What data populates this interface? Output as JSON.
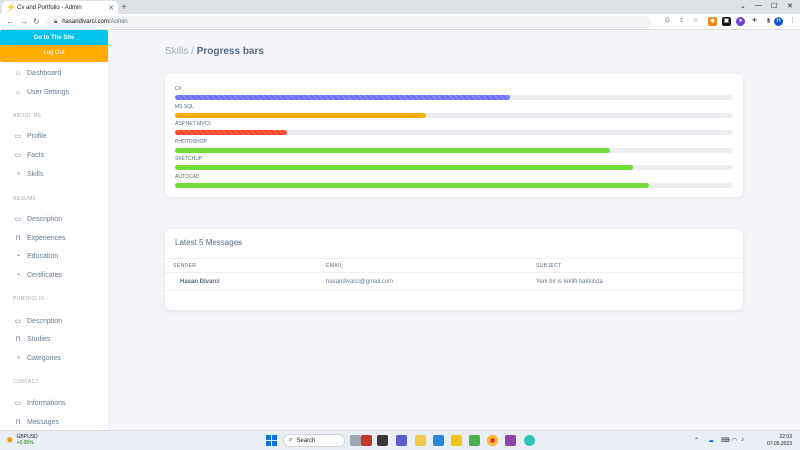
{
  "browser": {
    "tab_title": "Cv and Portfolio - Admin",
    "url_host": "hasandivarci.com",
    "url_path": "/Admin",
    "profile_initial": "H"
  },
  "sidebar": {
    "go_to_site": "Go to The Site",
    "logout": "Log Out",
    "items": [
      {
        "label": "Dashboard",
        "icon": "home-icon"
      },
      {
        "label": "User Settings",
        "icon": "home-icon"
      }
    ],
    "sections": [
      {
        "header": "ABOUT ME",
        "items": [
          {
            "label": "Profile",
            "icon": "calendar-icon"
          },
          {
            "label": "Facts",
            "icon": "calendar-icon"
          },
          {
            "label": "Skills",
            "icon": "dashboard-icon"
          }
        ]
      },
      {
        "header": "RESUME",
        "items": [
          {
            "label": "Description",
            "icon": "calendar-icon"
          },
          {
            "label": "Experiences",
            "icon": "lock-icon"
          },
          {
            "label": "Education",
            "icon": "dashboard-icon"
          },
          {
            "label": "Certificates",
            "icon": "dashboard-icon"
          }
        ]
      },
      {
        "header": "PORTFOLIO",
        "items": [
          {
            "label": "Description",
            "icon": "calendar-icon"
          },
          {
            "label": "Studies",
            "icon": "lock-icon"
          },
          {
            "label": "Categories",
            "icon": "dashboard-icon"
          }
        ]
      },
      {
        "header": "CONTACT",
        "items": [
          {
            "label": "Informations",
            "icon": "calendar-icon"
          },
          {
            "label": "Messages",
            "icon": "lock-icon"
          }
        ]
      }
    ]
  },
  "breadcrumb": {
    "parent": "Skills /",
    "current": "Progress bars"
  },
  "skills": [
    {
      "name": "C#",
      "percent": 60,
      "color": "#696cff",
      "striped": true
    },
    {
      "name": "MS SQL",
      "percent": 45,
      "color": "#ffab00",
      "striped": false
    },
    {
      "name": "ASP.NET MVC5",
      "percent": 20,
      "color": "#ff3e1d",
      "striped": true
    },
    {
      "name": "PHOTOSHOP",
      "percent": 78,
      "color": "#71dd37",
      "striped": false
    },
    {
      "name": "SKETCHUP",
      "percent": 82,
      "color": "#71dd37",
      "striped": false
    },
    {
      "name": "AUTOCAD",
      "percent": 85,
      "color": "#71dd37",
      "striped": false
    }
  ],
  "messages": {
    "title": "Latest 5 Messages",
    "columns": {
      "sender": "SENDER",
      "email": "EMAIL",
      "subject": "SUBJECT"
    },
    "rows": [
      {
        "sender": "Hasan Divarci",
        "email": "hasandivarci@gmail.com",
        "subject": "Yeni bir is teklifi hakkinda"
      }
    ]
  },
  "taskbar": {
    "ticker": "GBPUSD",
    "change": "+0.05%",
    "search": "Search",
    "time": "22:03",
    "date": "07.05.2023"
  }
}
